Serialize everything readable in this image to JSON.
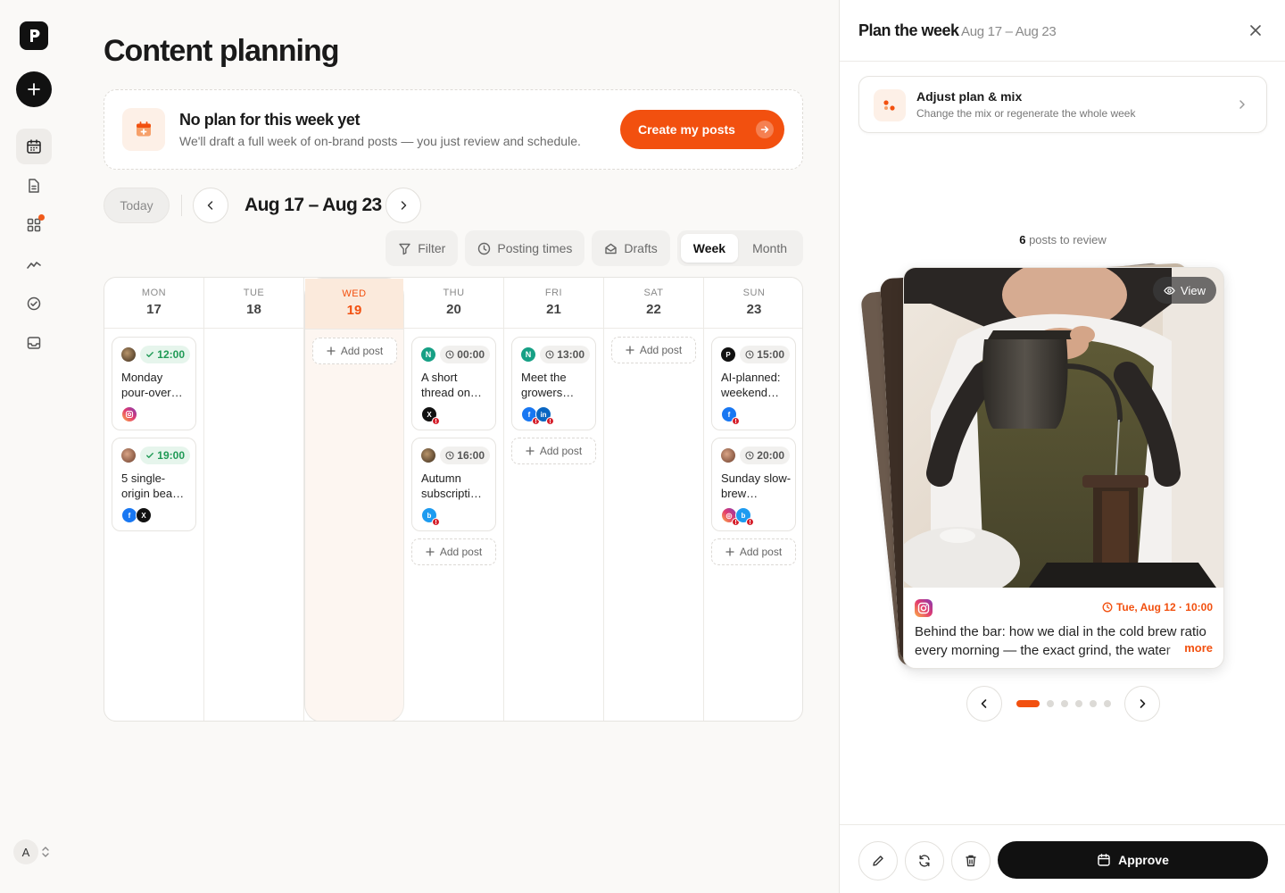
{
  "page": {
    "title": "Content planning"
  },
  "banner": {
    "title": "No plan for this week yet",
    "subtitle": "We'll draft a full week of on-brand posts — you just review and schedule.",
    "cta": "Create my posts"
  },
  "nav": {
    "today": "Today",
    "range": "Aug 17 – Aug 23",
    "filter": "Filter",
    "posting_times": "Posting times",
    "drafts": "Drafts",
    "week": "Week",
    "month": "Month"
  },
  "add_post_label": "Add post",
  "calendar": {
    "days": [
      {
        "name": "MON",
        "num": "17"
      },
      {
        "name": "TUE",
        "num": "18"
      },
      {
        "name": "WED",
        "num": "19"
      },
      {
        "name": "THU",
        "num": "20"
      },
      {
        "name": "FRI",
        "num": "21"
      },
      {
        "name": "SAT",
        "num": "22"
      },
      {
        "name": "SUN",
        "num": "23"
      }
    ],
    "posts": {
      "mon1": {
        "time": "12:00",
        "title": "Monday pour-over…",
        "status": "scheduled"
      },
      "mon2": {
        "time": "19:00",
        "title": "5 single-origin bea…",
        "status": "scheduled"
      },
      "thu1": {
        "time": "00:00",
        "title": "A short thread on…",
        "status": "draft"
      },
      "thu2": {
        "time": "16:00",
        "title": "Autumn subscripti…",
        "status": "draft"
      },
      "fri1": {
        "time": "13:00",
        "title": "Meet the growers…",
        "status": "draft"
      },
      "sun1": {
        "time": "15:00",
        "title": "AI-planned: weekend…",
        "status": "draft"
      },
      "sun2": {
        "time": "20:00",
        "title": "Sunday slow-brew…",
        "status": "draft"
      }
    }
  },
  "panel": {
    "title": "Plan the week",
    "range": "Aug 17 – Aug 23",
    "adjust_title": "Adjust plan & mix",
    "adjust_sub": "Change the mix or regenerate the whole week",
    "review_count": "6",
    "review_label": " posts to review",
    "view": "View",
    "post_time": "Tue, Aug 12 · 10:00",
    "post_text": "Behind the bar: how we dial in the cold brew ratio every morning — the exact grind, the water temperature and the steep time",
    "more": "more",
    "approve": "Approve",
    "page_dots": 6,
    "active_dot": 1
  },
  "colors": {
    "accent": "#f2500f",
    "success": "#1f9a55",
    "dark": "#111111"
  },
  "icons": [
    "logo-icon",
    "plus-icon",
    "calendar-icon",
    "document-icon",
    "apps-icon",
    "analytics-icon",
    "check-circle-icon",
    "inbox-icon",
    "filter-icon",
    "clock-icon",
    "drafts-icon",
    "chevron-left-icon",
    "chevron-right-icon",
    "close-icon",
    "eye-icon",
    "edit-icon",
    "refresh-icon",
    "trash-icon",
    "instagram-icon",
    "facebook-icon",
    "x-icon",
    "linkedin-icon",
    "bluesky-icon"
  ]
}
